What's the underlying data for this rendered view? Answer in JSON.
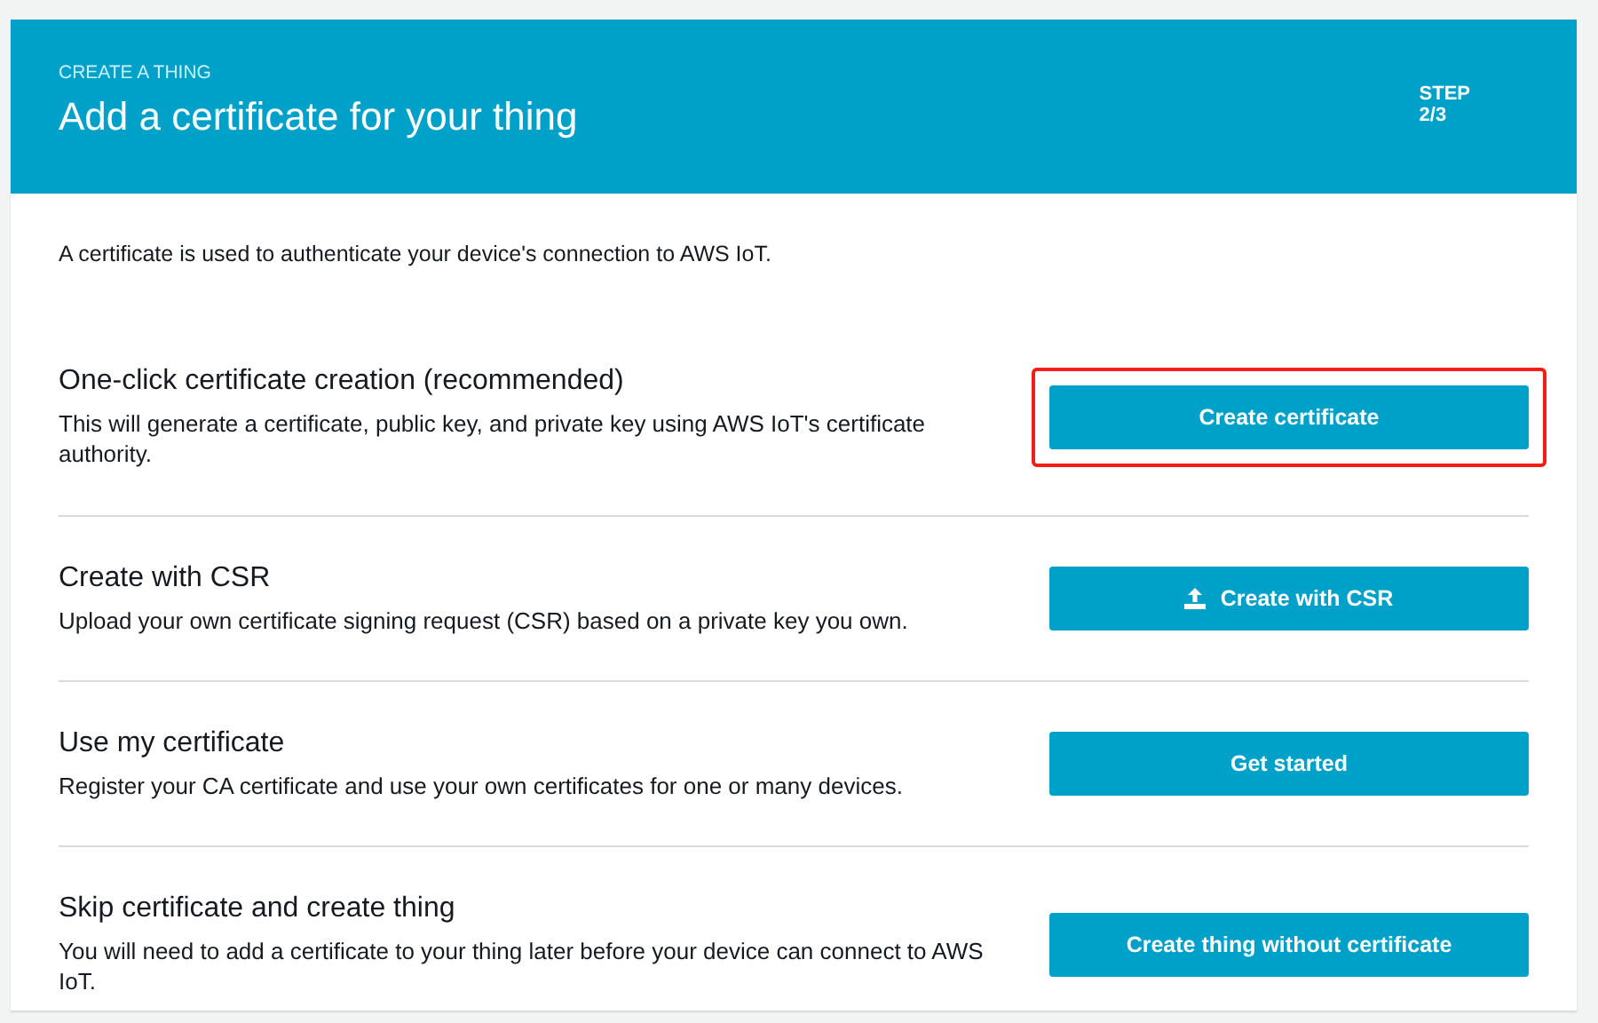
{
  "header": {
    "eyebrow": "CREATE A THING",
    "title": "Add a certificate for your thing",
    "step_label": "STEP",
    "step_value": "2/3"
  },
  "intro": "A certificate is used to authenticate your device's connection to AWS IoT.",
  "options": [
    {
      "title": "One-click certificate creation (recommended)",
      "description": "This will generate a certificate, public key, and private key using AWS IoT's certificate authority.",
      "button": "Create certificate",
      "kind": "plain",
      "highlighted": true
    },
    {
      "title": "Create with CSR",
      "description": "Upload your own certificate signing request (CSR) based on a private key you own.",
      "button": "Create with CSR",
      "kind": "upload",
      "highlighted": false
    },
    {
      "title": "Use my certificate",
      "description": "Register your CA certificate and use your own certificates for one or many devices.",
      "button": "Get started",
      "kind": "plain",
      "highlighted": false
    },
    {
      "title": "Skip certificate and create thing",
      "description": "You will need to add a certificate to your thing later before your device can connect to AWS IoT.",
      "button": "Create thing without certificate",
      "kind": "plain",
      "highlighted": false
    }
  ]
}
